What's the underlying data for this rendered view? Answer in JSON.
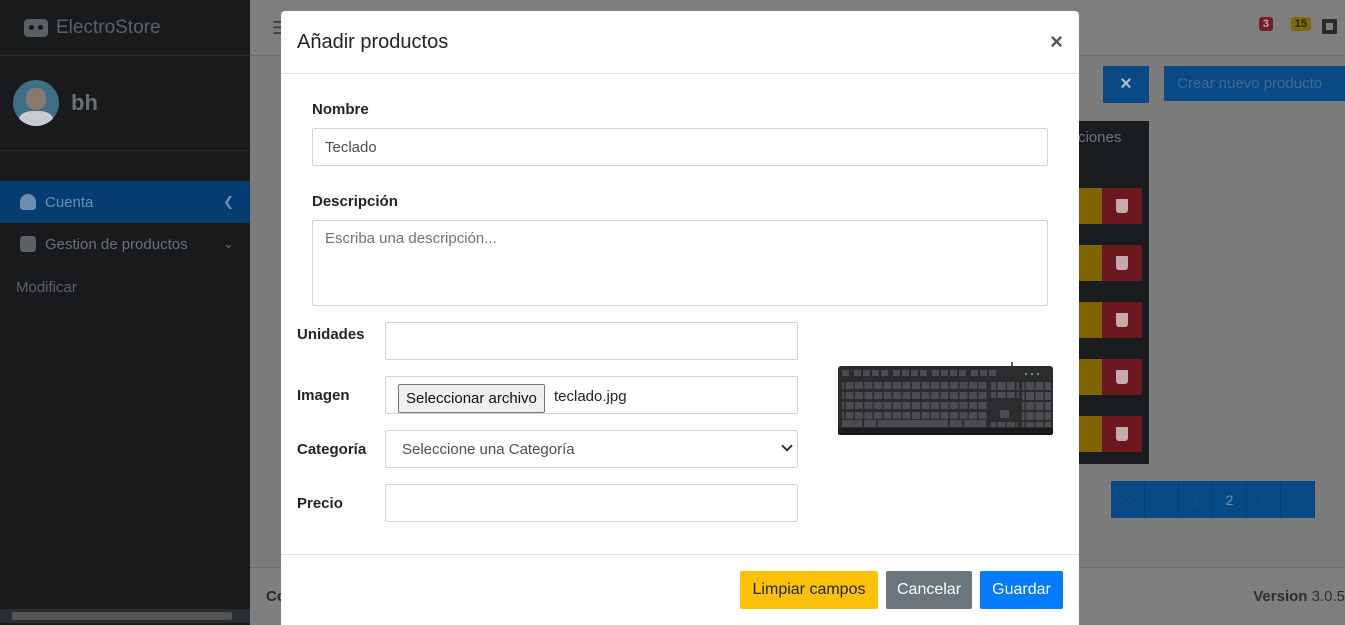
{
  "app": {
    "brand": "ElectroStore",
    "user_name": "bh"
  },
  "sidebar": {
    "items": [
      {
        "label": "Cuenta",
        "active": true
      },
      {
        "label": "Gestion de productos",
        "active": false
      }
    ],
    "sub_item": "Modificar"
  },
  "topbar": {
    "badge_messages": "3",
    "badge_notifications": "15"
  },
  "main": {
    "search_clear_label": "×",
    "create_button": "Crear nuevo producto",
    "table_actions_header": "ciones",
    "pagination": [
      "<<",
      "<",
      "1",
      "2",
      ">",
      ">>"
    ],
    "footer_left": "Co",
    "footer_version_label": "Version",
    "footer_version_value": "3.0.5"
  },
  "modal": {
    "title": "Añadir productos",
    "close": "×",
    "fields": {
      "nombre": {
        "label": "Nombre",
        "value": "Teclado"
      },
      "descripcion": {
        "label": "Descripción",
        "placeholder": "Escriba una descripción..."
      },
      "unidades": {
        "label": "Unidades",
        "value": ""
      },
      "imagen": {
        "label": "Imagen",
        "button": "Seleccionar archivo",
        "file_name": "teclado.jpg"
      },
      "categoria": {
        "label": "Categoría",
        "selected": "Seleccione una Categoría"
      },
      "precio": {
        "label": "Precio",
        "value": ""
      }
    },
    "buttons": {
      "clear": "Limpiar campos",
      "cancel": "Cancelar",
      "save": "Guardar"
    }
  },
  "colors": {
    "primary": "#007bff",
    "warning": "#ffc107",
    "secondary": "#6c757d",
    "sidebar_bg": "#181a1c"
  }
}
